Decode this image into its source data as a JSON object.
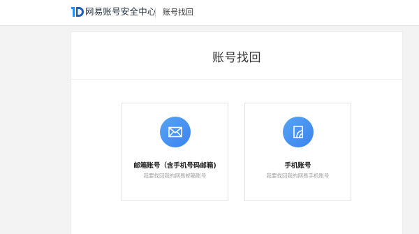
{
  "header": {
    "logo_text": "网易账号安全中心",
    "nav_title": "账号找回"
  },
  "panel": {
    "title": "账号找回"
  },
  "cards": [
    {
      "title": "邮箱账号（含手机号码邮箱)",
      "desc": "我要找回我的网易邮箱账号",
      "icon": "mail-icon"
    },
    {
      "title": "手机账号",
      "desc": "我要找回我的网易手机账号",
      "icon": "phone-icon"
    }
  ],
  "colors": {
    "accent": "#3b83ee",
    "background": "#f3f3f4"
  }
}
